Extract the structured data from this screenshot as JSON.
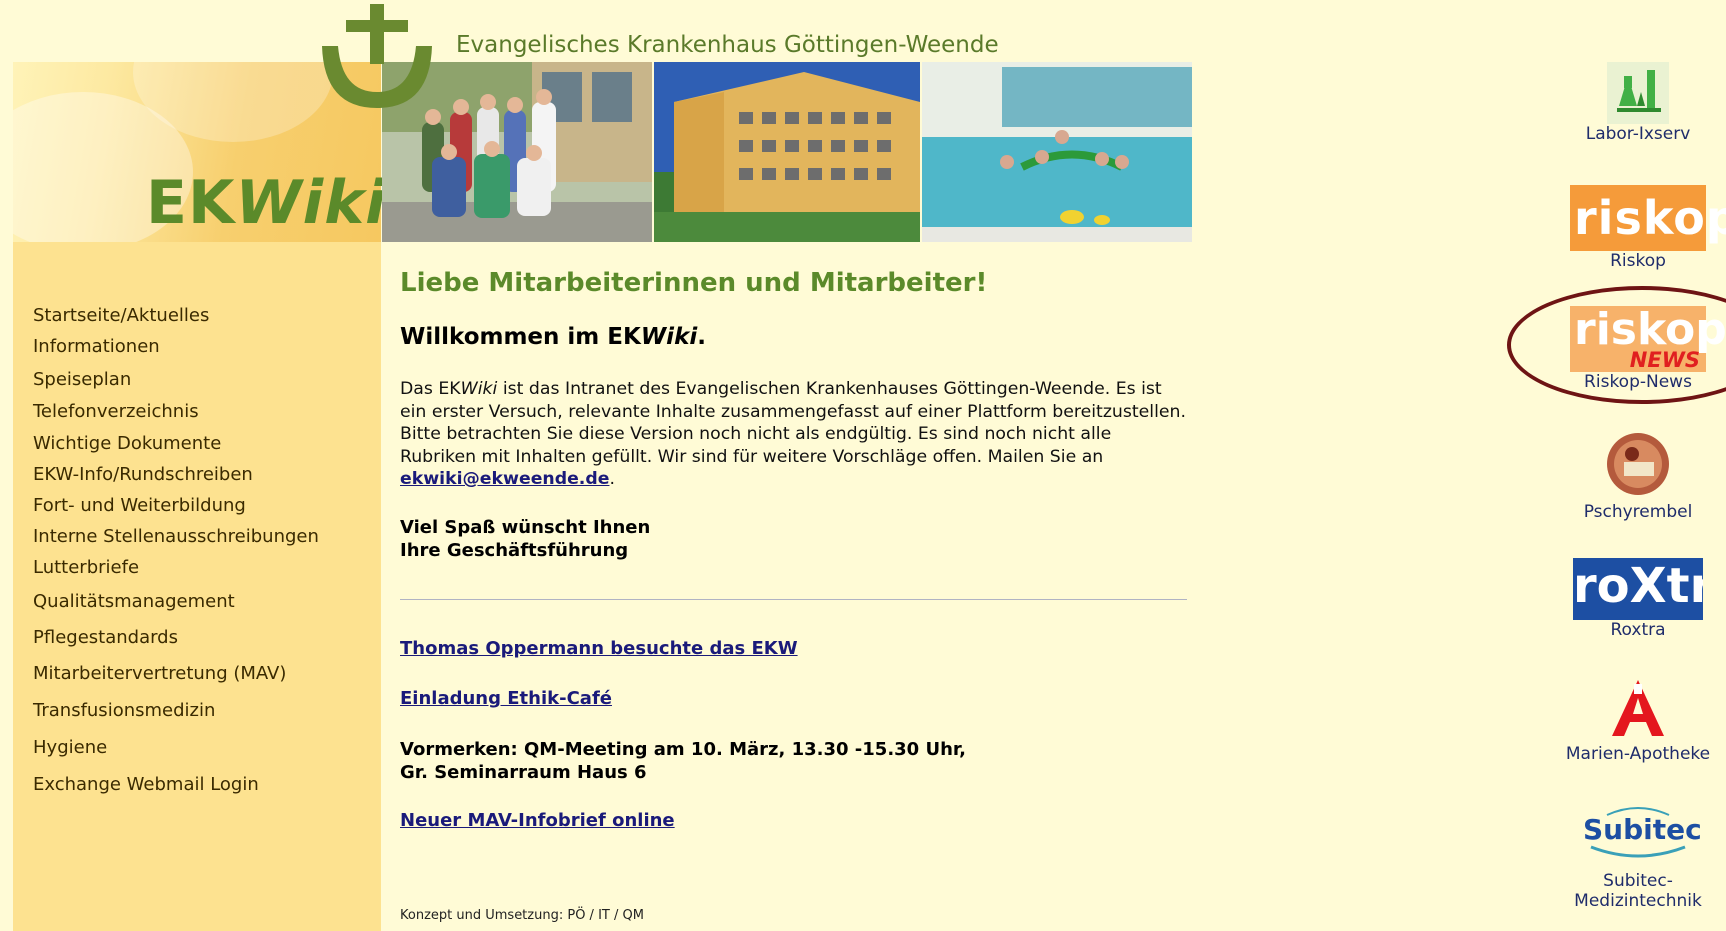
{
  "header": {
    "hospital_name": "Evangelisches Krankenhaus Göttingen-Weende",
    "logo_text_prefix": "EK",
    "logo_text_suffix": "Wiki"
  },
  "nav": [
    "Startseite/Aktuelles",
    "Informationen",
    "Speiseplan",
    "Telefonverzeichnis",
    "Wichtige Dokumente",
    "EKW-Info/Rundschreiben",
    "Fort- und Weiterbildung",
    "Interne Stellenausschreibungen",
    "Lutterbriefe",
    "Qualitätsmanagement",
    "Pflegestandards",
    "Mitarbeitervertretung (MAV)",
    "Transfusionsmedizin",
    "Hygiene",
    "Exchange Webmail Login"
  ],
  "main": {
    "greeting": "Liebe Mitarbeiterinnen und Mitarbeiter!",
    "welcome_prefix": "Willkommen im EK",
    "welcome_italic": "Wiki",
    "welcome_suffix": ".",
    "intro_1": "Das EK",
    "intro_italic": "Wiki",
    "intro_2": " ist das Intranet des Evangelischen Krankenhauses Göttingen-Weende. Es ist ein erster Versuch, relevante Inhalte zusammengefasst auf einer Plattform bereitzustellen. Bitte betrachten Sie diese Version noch nicht als endgültig. Es sind noch nicht alle Rubriken mit Inhalten gefüllt. Wir sind für weitere Vorschläge offen. Mailen Sie an ",
    "email": "ekwiki@ekweende.de",
    "intro_end": ".",
    "signoff_1": "Viel Spaß wünscht Ihnen",
    "signoff_2": "Ihre Geschäftsführung",
    "news_1": "Thomas Oppermann besuchte das EKW",
    "news_2": "Einladung Ethik-Café",
    "notice_1": "Vormerken: QM-Meeting am 10. März, 13.30 -15.30 Uhr,",
    "notice_2": "Gr. Seminarraum Haus 6",
    "news_3": "Neuer MAV-Infobrief online",
    "credits": "Konzept und Umsetzung: PÖ / IT / QM"
  },
  "right_links": {
    "labor": "Labor-Ixserv",
    "riskop": "Riskop",
    "riskop_news": "Riskop-News",
    "riskop_logo": "riskop",
    "news_logo": "NEWS",
    "pschyrembel": "Pschyrembel",
    "roxtra": "Roxtra",
    "roxtra_logo": "roXtra",
    "apotheke": "Marien-Apotheke",
    "subitec_logo": "Subitec",
    "subitec_1": "Subitec-",
    "subitec_2": "Medizintechnik"
  },
  "colors": {
    "background": "#fffbd6",
    "sidebar": "#fde290",
    "accent_green": "#5b8a2a",
    "link": "#1a1a7a",
    "highlight_circle": "#6e1414"
  }
}
